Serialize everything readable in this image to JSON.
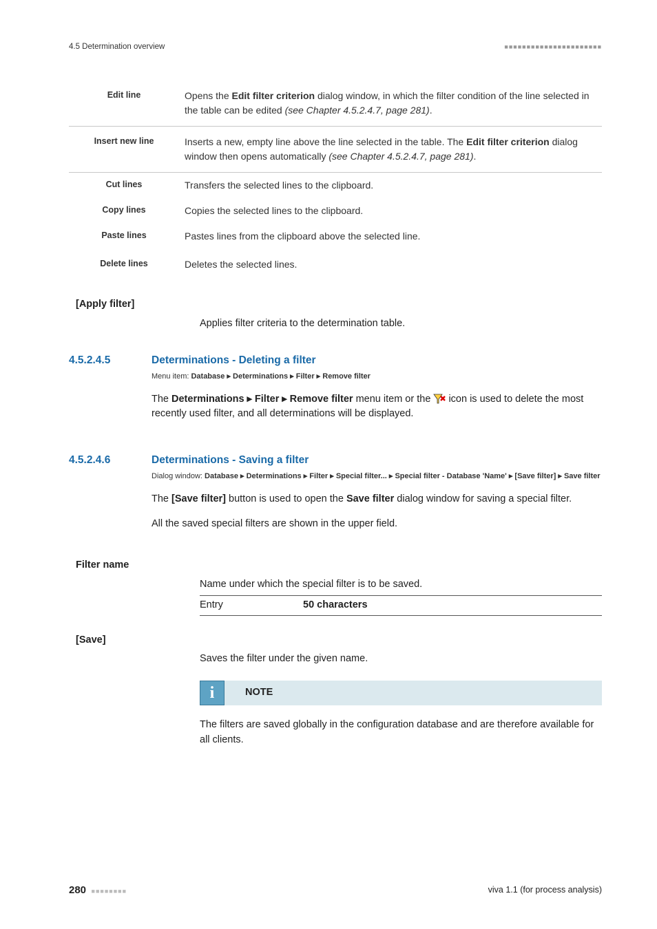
{
  "header": {
    "left": "4.5 Determination overview"
  },
  "table": {
    "edit_line": {
      "label": "Edit line",
      "desc_a": "Opens the ",
      "desc_b": "Edit filter criterion",
      "desc_c": " dialog window, in which the filter condition of the line selected in the table can be edited ",
      "desc_d": "(see Chapter 4.5.2.4.7, page 281)",
      "desc_e": "."
    },
    "insert_new_line": {
      "label": "Insert new line",
      "desc_a": "Inserts a new, empty line above the line selected in the table. The ",
      "desc_b": "Edit filter criterion",
      "desc_c": " dialog window then opens automatically ",
      "desc_d": "(see Chapter 4.5.2.4.7, page 281)",
      "desc_e": "."
    },
    "cut_lines": {
      "label": "Cut lines",
      "desc": "Transfers the selected lines to the clipboard."
    },
    "copy_lines": {
      "label": "Copy lines",
      "desc": "Copies the selected lines to the clipboard."
    },
    "paste_lines": {
      "label": "Paste lines",
      "desc": "Pastes lines from the clipboard above the selected line."
    },
    "delete_lines": {
      "label": "Delete lines",
      "desc": "Deletes the selected lines."
    }
  },
  "apply_filter": {
    "label": "[Apply filter]",
    "desc": "Applies filter criteria to the determination table."
  },
  "sec_delete": {
    "num": "4.5.2.4.5",
    "title": "Determinations - Deleting a filter",
    "meta": "Menu item: Database ▸ Determinations ▸ Filter ▸ Remove filter",
    "text_a": "The ",
    "text_b": "Determinations ▸ Filter ▸ Remove filter",
    "text_c": " menu item or the ",
    "text_d": " icon is used to delete the most recently used filter, and all determinations will be displayed."
  },
  "sec_save": {
    "num": "4.5.2.4.6",
    "title": "Determinations - Saving a filter",
    "meta": "Dialog window: Database ▸ Determinations ▸ Filter ▸ Special filter... ▸ Special filter - Database 'Name' ▸ [Save filter] ▸ Save filter",
    "text1_a": "The ",
    "text1_b": "[Save filter]",
    "text1_c": " button is used to open the ",
    "text1_d": "Save filter",
    "text1_e": " dialog window for saving a special filter.",
    "text2": "All the saved special filters are shown in the upper field."
  },
  "filter_name": {
    "label": "Filter name",
    "desc": "Name under which the special filter is to be saved.",
    "entry_label": "Entry",
    "entry_val": "50 characters"
  },
  "save": {
    "label": "[Save]",
    "desc": "Saves the filter under the given name."
  },
  "note": {
    "label": "NOTE",
    "body": "The filters are saved globally in the configuration database and are therefore available for all clients."
  },
  "footer": {
    "page": "280",
    "right": "viva 1.1 (for process analysis)"
  }
}
